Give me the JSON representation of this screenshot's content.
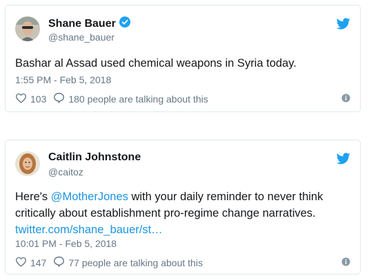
{
  "tweets": [
    {
      "name": "Shane Bauer",
      "verified": true,
      "handle": "@shane_bauer",
      "text": "Bashar al Assad used chemical weapons in Syria today.",
      "timestamp": "1:55 PM - Feb 5, 2018",
      "likes": "103",
      "talking": "180 people are talking about this"
    },
    {
      "name": "Caitlin Johnstone",
      "verified": false,
      "handle": "@caitoz",
      "text_prefix": "Here's ",
      "mention": "@MotherJones",
      "text_line1_rest": " with your daily reminder to never think",
      "text_line2": "critically about establishment pro-regime change narratives.",
      "link": "twitter.com/shane_bauer/st…",
      "timestamp": "10:01 PM - Feb 5, 2018",
      "likes": "147",
      "talking": "77 people are talking about this"
    }
  ],
  "colors": {
    "twitter_blue": "#1da1f2",
    "link_blue": "#1b95e0",
    "muted": "#657786",
    "border": "#e1e8ed"
  }
}
